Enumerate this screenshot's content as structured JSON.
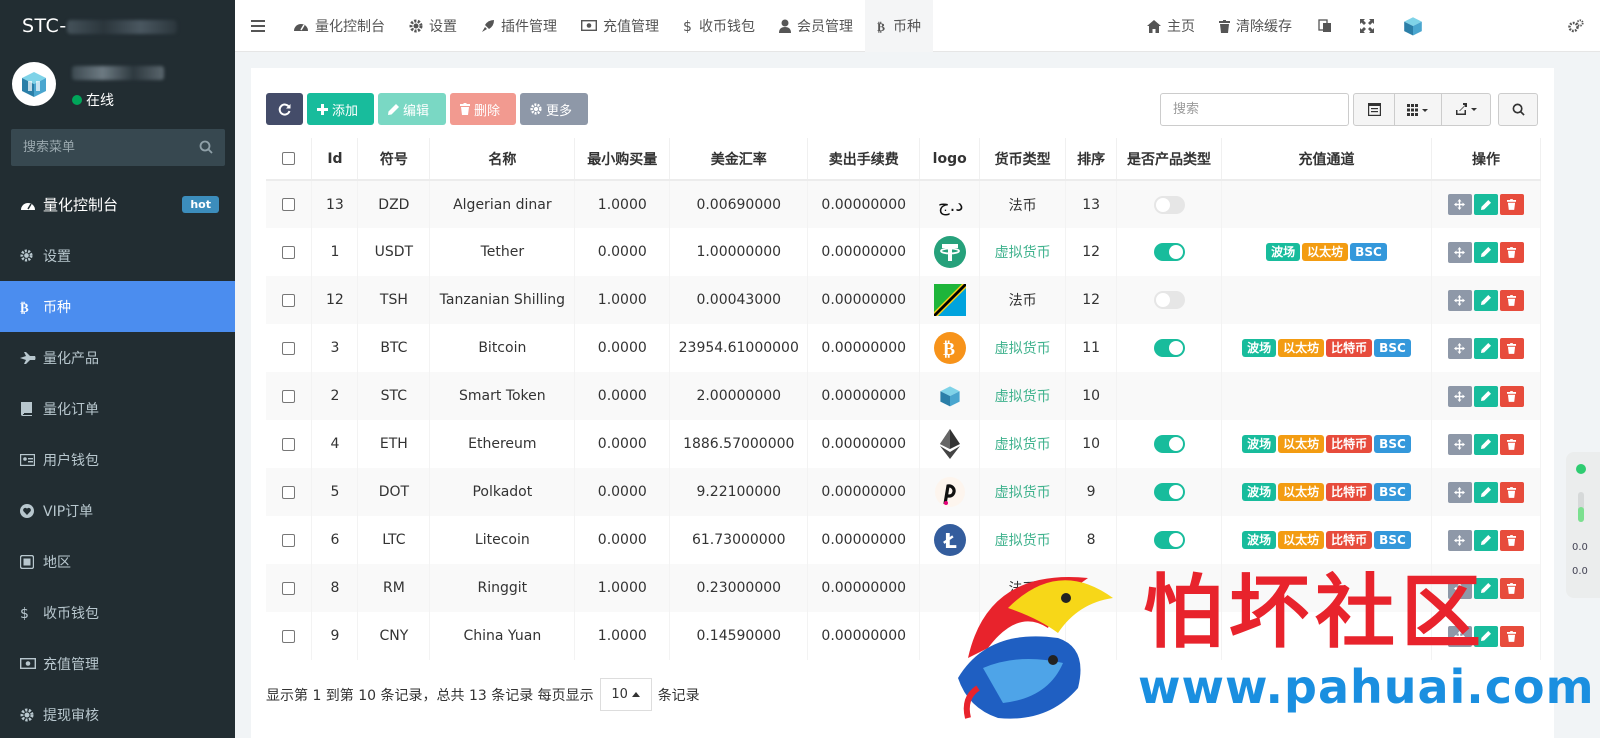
{
  "brand": {
    "prefix": "STC-"
  },
  "user": {
    "status": "在线"
  },
  "sidebar": {
    "search_placeholder": "搜索菜单",
    "items": [
      {
        "label": "量化控制台",
        "icon": "dashboard-icon",
        "badge": "hot"
      },
      {
        "label": "设置",
        "icon": "gear-icon"
      },
      {
        "label": "币种",
        "icon": "bitcoin-icon"
      },
      {
        "label": "量化产品",
        "icon": "plane-icon"
      },
      {
        "label": "量化订单",
        "icon": "book-icon"
      },
      {
        "label": "用户钱包",
        "icon": "id-card-icon"
      },
      {
        "label": "VIP订单",
        "icon": "heart-icon"
      },
      {
        "label": "地区",
        "icon": "globe-icon"
      },
      {
        "label": "收币钱包",
        "icon": "dollar-icon"
      },
      {
        "label": "充值管理",
        "icon": "money-icon"
      },
      {
        "label": "提现审核",
        "icon": "settings-icon"
      }
    ]
  },
  "topnav": {
    "tabs": [
      {
        "label": "量化控制台",
        "icon": "dashboard-icon"
      },
      {
        "label": "设置",
        "icon": "gear-icon"
      },
      {
        "label": "插件管理",
        "icon": "rocket-icon"
      },
      {
        "label": "充值管理",
        "icon": "money-icon"
      },
      {
        "label": "收币钱包",
        "icon": "dollar-icon"
      },
      {
        "label": "会员管理",
        "icon": "user-icon"
      },
      {
        "label": "币种",
        "icon": "bitcoin-icon"
      }
    ],
    "home": "主页",
    "clear_cache": "清除缓存"
  },
  "toolbar": {
    "add": "添加",
    "edit": "编辑",
    "delete": "删除",
    "more": "更多",
    "search_placeholder": "搜索"
  },
  "table": {
    "headers": [
      "Id",
      "符号",
      "名称",
      "最小购买量",
      "美金汇率",
      "卖出手续费",
      "logo",
      "货币类型",
      "排序",
      "是否产品类型",
      "充值通道",
      "操作"
    ],
    "rows": [
      {
        "id": "13",
        "symbol": "DZD",
        "name": "Algerian dinar",
        "min": "1.0000",
        "rate": "0.00690000",
        "fee": "0.00000000",
        "logo": "dzd",
        "type": "法币",
        "virtual": false,
        "sort": "13",
        "product": false,
        "channels": []
      },
      {
        "id": "1",
        "symbol": "USDT",
        "name": "Tether",
        "min": "0.0000",
        "rate": "1.00000000",
        "fee": "0.00000000",
        "logo": "usdt",
        "type": "虚拟货币",
        "virtual": true,
        "sort": "12",
        "product": true,
        "channels": [
          "波场",
          "以太坊",
          "BSC"
        ]
      },
      {
        "id": "12",
        "symbol": "TSH",
        "name": "Tanzanian Shilling",
        "min": "1.0000",
        "rate": "0.00043000",
        "fee": "0.00000000",
        "logo": "tsh",
        "type": "法币",
        "virtual": false,
        "sort": "12",
        "product": false,
        "channels": []
      },
      {
        "id": "3",
        "symbol": "BTC",
        "name": "Bitcoin",
        "min": "0.0000",
        "rate": "23954.61000000",
        "fee": "0.00000000",
        "logo": "btc",
        "type": "虚拟货币",
        "virtual": true,
        "sort": "11",
        "product": true,
        "channels": [
          "波场",
          "以太坊",
          "比特币",
          "BSC"
        ]
      },
      {
        "id": "2",
        "symbol": "STC",
        "name": "Smart Token",
        "min": "0.0000",
        "rate": "2.00000000",
        "fee": "0.00000000",
        "logo": "stc",
        "type": "虚拟货币",
        "virtual": true,
        "sort": "10",
        "product": null,
        "channels": []
      },
      {
        "id": "4",
        "symbol": "ETH",
        "name": "Ethereum",
        "min": "0.0000",
        "rate": "1886.57000000",
        "fee": "0.00000000",
        "logo": "eth",
        "type": "虚拟货币",
        "virtual": true,
        "sort": "10",
        "product": true,
        "channels": [
          "波场",
          "以太坊",
          "比特币",
          "BSC"
        ]
      },
      {
        "id": "5",
        "symbol": "DOT",
        "name": "Polkadot",
        "min": "0.0000",
        "rate": "9.22100000",
        "fee": "0.00000000",
        "logo": "dot",
        "type": "虚拟货币",
        "virtual": true,
        "sort": "9",
        "product": true,
        "channels": [
          "波场",
          "以太坊",
          "比特币",
          "BSC"
        ]
      },
      {
        "id": "6",
        "symbol": "LTC",
        "name": "Litecoin",
        "min": "0.0000",
        "rate": "61.73000000",
        "fee": "0.00000000",
        "logo": "ltc",
        "type": "虚拟货币",
        "virtual": true,
        "sort": "8",
        "product": true,
        "channels": [
          "波场",
          "以太坊",
          "比特币",
          "BSC"
        ]
      },
      {
        "id": "8",
        "symbol": "RM",
        "name": "Ringgit",
        "min": "1.0000",
        "rate": "0.23000000",
        "fee": "0.00000000",
        "logo": "",
        "type": "法币",
        "virtual": false,
        "sort": "",
        "product": null,
        "channels": []
      },
      {
        "id": "9",
        "symbol": "CNY",
        "name": "China Yuan",
        "min": "1.0000",
        "rate": "0.14590000",
        "fee": "0.00000000",
        "logo": "",
        "type": "",
        "virtual": false,
        "sort": "",
        "product": null,
        "channels": []
      }
    ]
  },
  "pagination": {
    "summary": "显示第 1 到第 10 条记录，总共 13 条记录 每页显示",
    "page_size": "10",
    "suffix": "条记录"
  },
  "watermark": {
    "text": "怕坏社区",
    "url": "www.pahuai.com"
  },
  "side_widget": {
    "up": "0.0",
    "down": "0.0"
  },
  "colors": {
    "sidebar": "#222d32",
    "active": "#4b8def",
    "success": "#18bc9c",
    "danger": "#e74c3c",
    "warning": "#f39c12",
    "info": "#3498db"
  }
}
